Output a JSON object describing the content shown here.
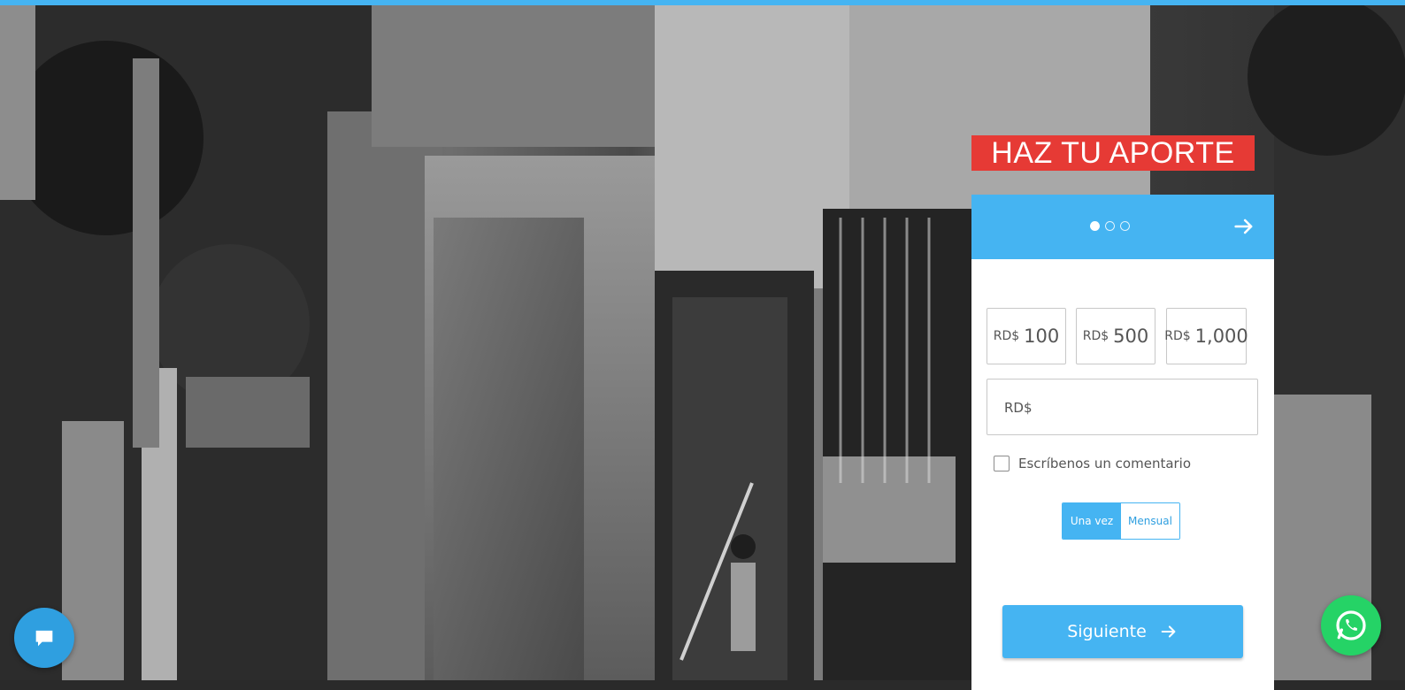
{
  "hero": {
    "image_description_icon": "photo-background"
  },
  "banner": {
    "title": "HAZ TU APORTE"
  },
  "donation_form": {
    "header": {
      "steps_total": 3,
      "current_step": 1,
      "next_icon": "arrow-right-icon"
    },
    "currency": "RD$",
    "amounts": [
      {
        "currency": "RD$",
        "value": "100"
      },
      {
        "currency": "RD$",
        "value": "500"
      },
      {
        "currency": "RD$",
        "value": "1,000"
      }
    ],
    "custom_amount": {
      "currency": "RD$",
      "value": "",
      "placeholder": ""
    },
    "comment_checkbox": {
      "label": "Escríbenos un comentario",
      "checked": false
    },
    "frequency": {
      "options": [
        "Una vez",
        "Mensual"
      ],
      "selected": "Una vez"
    },
    "submit": {
      "label": "Siguiente",
      "icon": "arrow-right-icon"
    }
  },
  "widgets": {
    "chat_icon": "chat-bubble-icon",
    "whatsapp_icon": "whatsapp-icon"
  },
  "colors": {
    "accent": "#45b4f2",
    "banner_red": "#e63a35",
    "whatsapp_green": "#25d366"
  }
}
